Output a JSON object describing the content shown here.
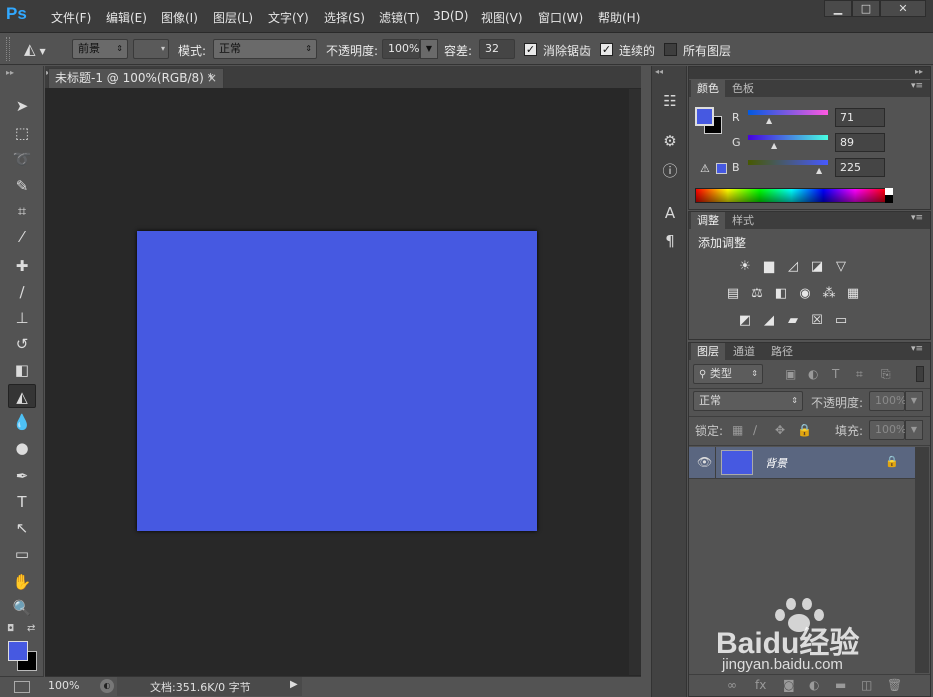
{
  "app": {
    "logo": "Ps"
  },
  "menu": [
    "文件(F)",
    "编辑(E)",
    "图像(I)",
    "图层(L)",
    "文字(Y)",
    "选择(S)",
    "滤镜(T)",
    "3D(D)",
    "视图(V)",
    "窗口(W)",
    "帮助(H)"
  ],
  "window_controls": {
    "minimize": "▁",
    "maximize": "□",
    "close": "✕"
  },
  "options": {
    "fill_source": "前景",
    "mode_label": "模式:",
    "mode_value": "正常",
    "opacity_label": "不透明度:",
    "opacity_value": "100%",
    "tolerance_label": "容差:",
    "tolerance_value": "32",
    "antialias_label": "消除锯齿",
    "antialias_checked": true,
    "contiguous_label": "连续的",
    "contiguous_checked": true,
    "all_layers_label": "所有图层",
    "all_layers_checked": false
  },
  "document": {
    "tab_title": "未标题-1 @ 100%(RGB/8) *",
    "close": "×",
    "canvas_color": "#4659e1",
    "zoom": "100%",
    "doc_info": "文档:351.6K/0 字节"
  },
  "tools": [
    "move-icon",
    "marquee-icon",
    "lasso-icon",
    "quick-select-icon",
    "crop-icon",
    "eyedropper-icon",
    "healing-icon",
    "brush-icon",
    "stamp-icon",
    "history-brush-icon",
    "eraser-icon",
    "paint-bucket-icon",
    "blur-icon",
    "dodge-icon",
    "pen-icon",
    "type-icon",
    "path-select-icon",
    "rectangle-icon",
    "hand-icon",
    "zoom-icon"
  ],
  "colors": {
    "foreground": "#4659e1",
    "background": "#000000"
  },
  "color_panel": {
    "tabs": [
      "颜色",
      "色板"
    ],
    "r_label": "R",
    "r_value": "71",
    "g_label": "G",
    "g_value": "89",
    "b_label": "B",
    "b_value": "225"
  },
  "adjust_panel": {
    "tabs": [
      "调整",
      "样式"
    ],
    "title": "添加调整"
  },
  "layers_panel": {
    "tabs": [
      "图层",
      "通道",
      "路径"
    ],
    "filter_kind": "类型",
    "blend_mode": "正常",
    "opacity_label": "不透明度:",
    "opacity_value": "100%",
    "lock_label": "锁定:",
    "fill_label": "填充:",
    "fill_value": "100%",
    "layers": [
      {
        "name": "背景",
        "color": "#4659e1",
        "locked": true
      }
    ]
  },
  "watermark": {
    "brand": "Baidu经验",
    "url": "jingyan.baidu.com"
  }
}
